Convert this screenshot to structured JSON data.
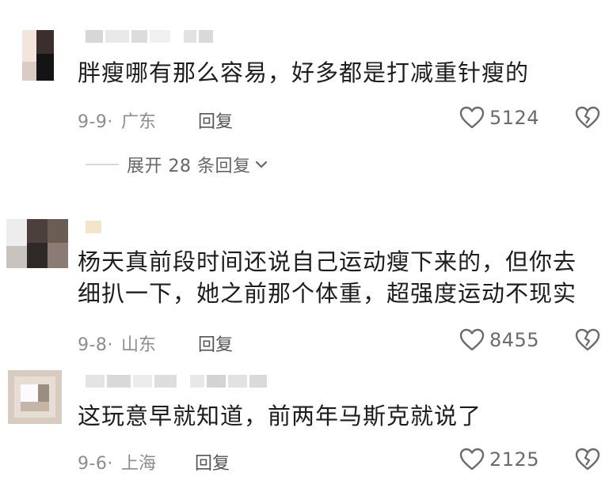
{
  "comments": [
    {
      "text": "胖瘦哪有那么容易，好多都是打减重针瘦的",
      "date": "9-9·",
      "location": "广东",
      "reply_label": "回复",
      "likes": "5124",
      "expand_label": "展开 28 条回复"
    },
    {
      "text": "杨天真前段时间还说自己运动瘦下来的，但你去细扒一下，她之前那个体重，超强度运动不现实",
      "date": "9-8·",
      "location": "山东",
      "reply_label": "回复",
      "likes": "8455"
    },
    {
      "text": "这玩意早就知道，前两年马斯克就说了",
      "date": "9-6·",
      "location": "上海",
      "reply_label": "回复",
      "likes": "2125"
    }
  ],
  "icons": {
    "like": "heart-outline-icon",
    "dislike": "broken-heart-icon",
    "expand": "chevron-down-icon"
  },
  "colors": {
    "text": "#1d1d1d",
    "meta": "#8d8d8d",
    "icon": "#6b6b6b"
  }
}
